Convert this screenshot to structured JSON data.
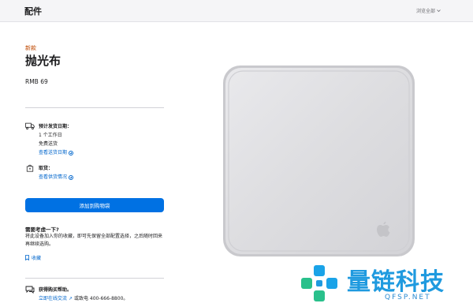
{
  "header": {
    "title": "配件",
    "browse_label": "浏览全部"
  },
  "product": {
    "badge": "新款",
    "name": "抛光布",
    "price": "RMB 69"
  },
  "delivery": {
    "title": "预计发货日期：",
    "line1": "1 个工作日",
    "line2": "免费送货",
    "link": "查看送货日期"
  },
  "pickup": {
    "title": "取货：",
    "link": "查看供货情况"
  },
  "cta": {
    "add_to_bag": "添加到购物袋"
  },
  "consider": {
    "title": "需要考虑一下?",
    "body": "将此设备加入你的收藏，即可先保留全部配置选择，之后随时回来再继续选购。",
    "save_label": "收藏"
  },
  "help": {
    "title": "获得购买帮助。",
    "chat_link": "立即在线交流",
    "phone_text": "或致电 400-666-8800。"
  },
  "watermark": {
    "text": "量链科技",
    "sub": "QFSP.NET"
  },
  "colors": {
    "accent": "#0071e3",
    "link": "#0066cc",
    "badge": "#bf4800",
    "watermark": "#1f9adf"
  }
}
